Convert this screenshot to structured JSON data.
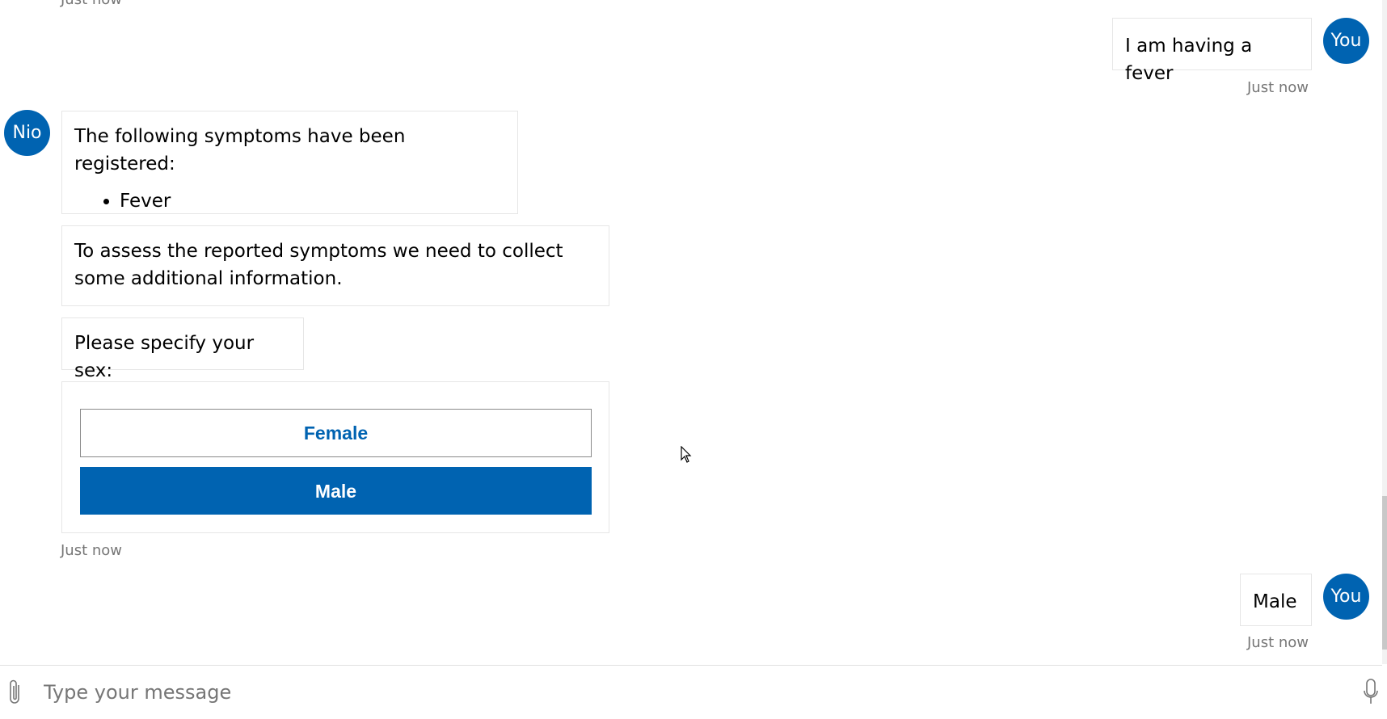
{
  "messages": {
    "partial_timestamp": "Just now",
    "user_1": {
      "avatar": "You",
      "text": "I am having a fever",
      "timestamp": "Just now"
    },
    "bot": {
      "avatar": "Nio",
      "symptoms_intro": "The following symptoms have been registered:",
      "symptoms": [
        "Fever"
      ],
      "assess_text": "To assess the reported symptoms we need to collect some additional information.",
      "sex_prompt": "Please specify your sex:",
      "options": [
        "Female",
        "Male"
      ],
      "timestamp": "Just now"
    },
    "user_2": {
      "avatar": "You",
      "text": "Male",
      "timestamp": "Just now"
    }
  },
  "composer": {
    "placeholder": "Type your message"
  },
  "icons": {
    "attach": "paperclip-icon",
    "mic": "microphone-icon",
    "cursor": "mouse-pointer-icon"
  },
  "colors": {
    "accent": "#0063b1",
    "timestamp": "#767676",
    "border": "#e6e6e6"
  }
}
